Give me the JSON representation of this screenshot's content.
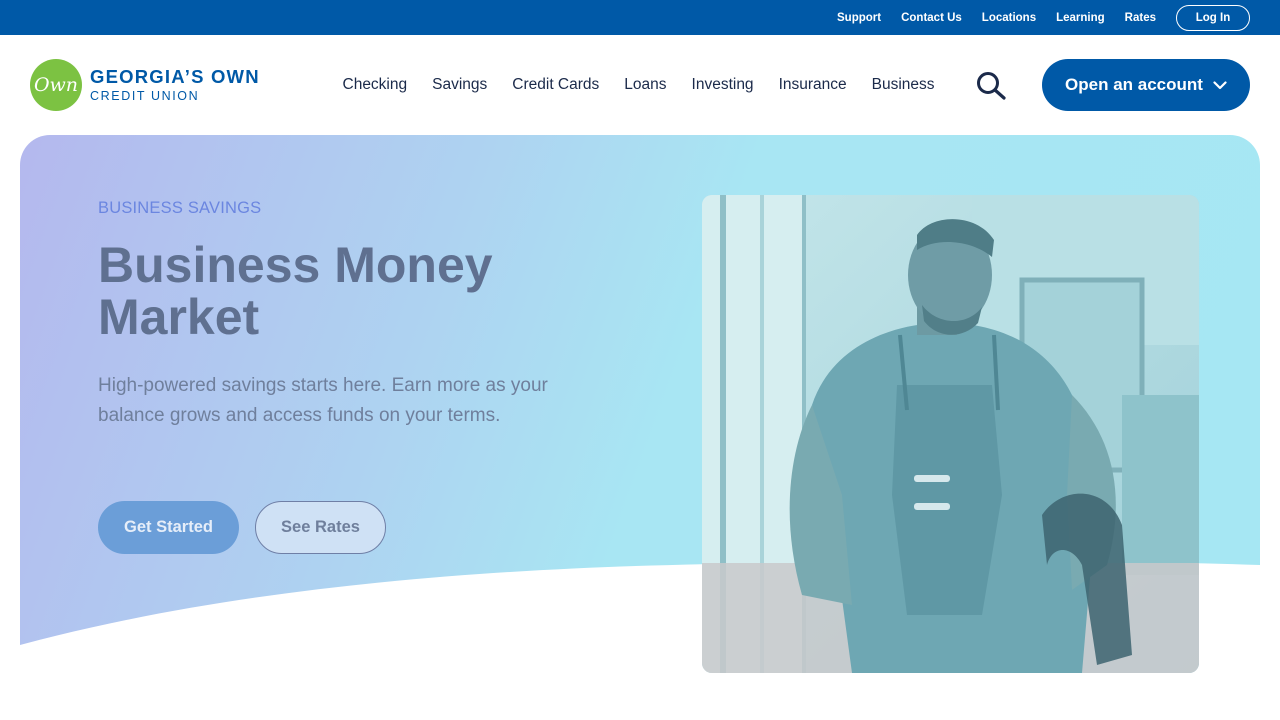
{
  "utility_nav": {
    "links": [
      "Support",
      "Contact Us",
      "Locations",
      "Learning",
      "Rates"
    ],
    "login_label": "Log In"
  },
  "logo": {
    "mark": "Own",
    "title": "GEORGIA’S OWN",
    "subtitle": "CREDIT UNION"
  },
  "main_nav": {
    "items": [
      "Checking",
      "Savings",
      "Credit Cards",
      "Loans",
      "Investing",
      "Insurance",
      "Business"
    ],
    "search_icon": "search-icon",
    "cta_label": "Open an account",
    "cta_icon": "chevron-down-icon"
  },
  "hero": {
    "eyebrow": "BUSINESS SAVINGS",
    "title": "Business Money Market",
    "description": "High-powered savings starts here. Earn more as your balance grows and access funds on your terms.",
    "primary_button": "Get Started",
    "secondary_button": "See Rates"
  },
  "colors": {
    "brand_blue": "#0059a7",
    "brand_green": "#7cc242",
    "hero_gradient_start": "#b4b8ee",
    "hero_gradient_end": "#a6e7f3"
  }
}
